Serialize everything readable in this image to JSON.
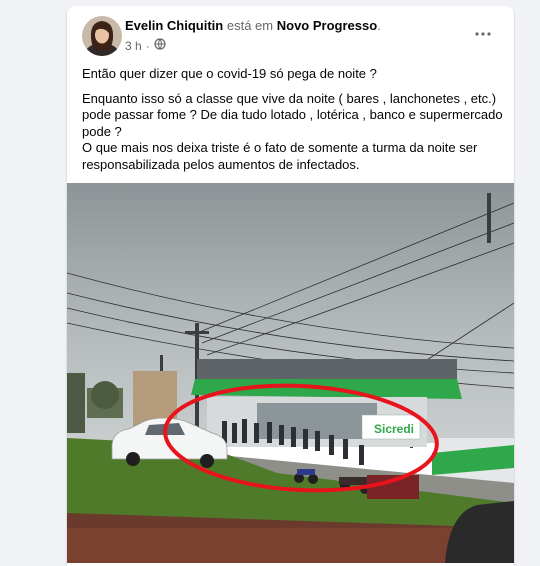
{
  "post": {
    "author": "Evelin Chiquitin",
    "verb": "está em",
    "location": "Novo Progresso",
    "location_suffix": ".",
    "time": "3 h",
    "dot": "·",
    "paragraphs": [
      "Então quer dizer que o covid-19 só pega de noite ?",
      "Enquanto isso só a classe que vive da noite ( bares , lanchonetes , etc.) pode passar fome ? De dia tudo lotado , lotérica , banco e supermercado pode ?",
      "O que mais nos deixa triste é o fato de somente a turma da noite ser responsabilizada pelos aumentos de infectados."
    ],
    "photo": {
      "sign_text": "Sicredi",
      "highlight_color": "#e8141b"
    }
  },
  "icons": {
    "privacy": "globe-icon",
    "more": "more-horizontal-icon"
  },
  "colors": {
    "page_bg": "#f0f2f5",
    "card_bg": "#ffffff",
    "text": "#050505",
    "secondary_text": "#65676b",
    "bank_green": "#2ea84a"
  }
}
